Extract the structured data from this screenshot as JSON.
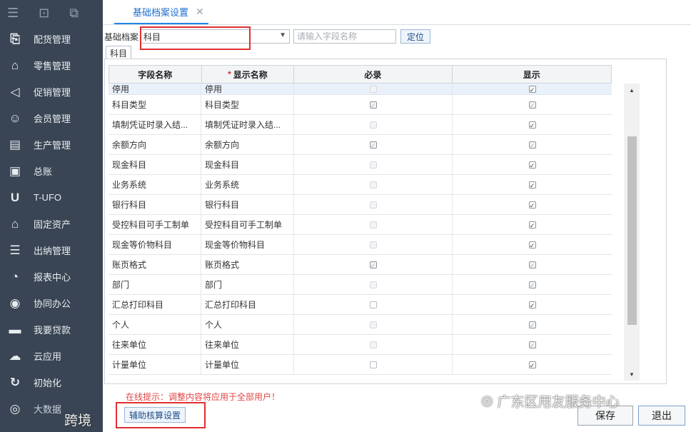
{
  "sidebar": {
    "items": [
      {
        "label": "配货管理",
        "icon": "dispatch-icon"
      },
      {
        "label": "零售管理",
        "icon": "retail-icon"
      },
      {
        "label": "促销管理",
        "icon": "megaphone-icon"
      },
      {
        "label": "会员管理",
        "icon": "member-icon"
      },
      {
        "label": "生产管理",
        "icon": "production-icon"
      },
      {
        "label": "总账",
        "icon": "ledger-icon"
      },
      {
        "label": "T-UFO",
        "icon": "ufo-icon"
      },
      {
        "label": "固定资产",
        "icon": "bank-icon"
      },
      {
        "label": "出纳管理",
        "icon": "cashier-icon"
      },
      {
        "label": "报表中心",
        "icon": "pie-chart-icon"
      },
      {
        "label": "协同办公",
        "icon": "collaboration-icon"
      },
      {
        "label": "我要贷款",
        "icon": "loan-icon"
      },
      {
        "label": "云应用",
        "icon": "cloud-icon"
      },
      {
        "label": "初始化",
        "icon": "refresh-icon"
      },
      {
        "label": "大数据",
        "icon": "big-data-icon"
      }
    ]
  },
  "tab": {
    "label": "基础档案设置",
    "close": "✕"
  },
  "filter": {
    "label": "基础档案",
    "value": "科目",
    "search_placeholder": "请输入字段名称",
    "locate_button": "定位"
  },
  "subtab": "科目",
  "table": {
    "headers": {
      "field": "字段名称",
      "display": "显示名称",
      "required": "必录",
      "show": "显示",
      "required_mark": "*"
    },
    "rows": [
      {
        "field": "停用",
        "display": "停用",
        "required": "disabled",
        "show": "checked"
      },
      {
        "field": "科目类型",
        "display": "科目类型",
        "required": "checked-disabled",
        "show": "checked-disabled"
      },
      {
        "field": "填制凭证时录入结...",
        "display": "填制凭证时录入结...",
        "required": "disabled",
        "show": "checked"
      },
      {
        "field": "余额方向",
        "display": "余额方向",
        "required": "checked-disabled",
        "show": "checked-disabled"
      },
      {
        "field": "现金科目",
        "display": "现金科目",
        "required": "disabled",
        "show": "checked"
      },
      {
        "field": "业务系统",
        "display": "业务系统",
        "required": "disabled",
        "show": "checked"
      },
      {
        "field": "银行科目",
        "display": "银行科目",
        "required": "disabled",
        "show": "checked"
      },
      {
        "field": "受控科目可手工制单",
        "display": "受控科目可手工制单",
        "required": "disabled",
        "show": "checked"
      },
      {
        "field": "现金等价物科目",
        "display": "现金等价物科目",
        "required": "disabled",
        "show": "checked"
      },
      {
        "field": "账页格式",
        "display": "账页格式",
        "required": "checked-disabled",
        "show": "checked-disabled"
      },
      {
        "field": "部门",
        "display": "部门",
        "required": "disabled",
        "show": "checked-disabled"
      },
      {
        "field": "汇总打印科目",
        "display": "汇总打印科目",
        "required": "unchecked",
        "show": "checked"
      },
      {
        "field": "个人",
        "display": "个人",
        "required": "disabled",
        "show": "checked-disabled"
      },
      {
        "field": "往来单位",
        "display": "往来单位",
        "required": "disabled",
        "show": "checked-disabled"
      },
      {
        "field": "计量单位",
        "display": "计量单位",
        "required": "unchecked",
        "show": "checked"
      }
    ]
  },
  "tip": "在线提示：调整内容将应用于全部用户！",
  "buttons": {
    "aux": "辅助核算设置",
    "save": "保存",
    "exit": "退出"
  },
  "watermark": {
    "main": "广东区用友服务中心",
    "side": "跨境"
  }
}
